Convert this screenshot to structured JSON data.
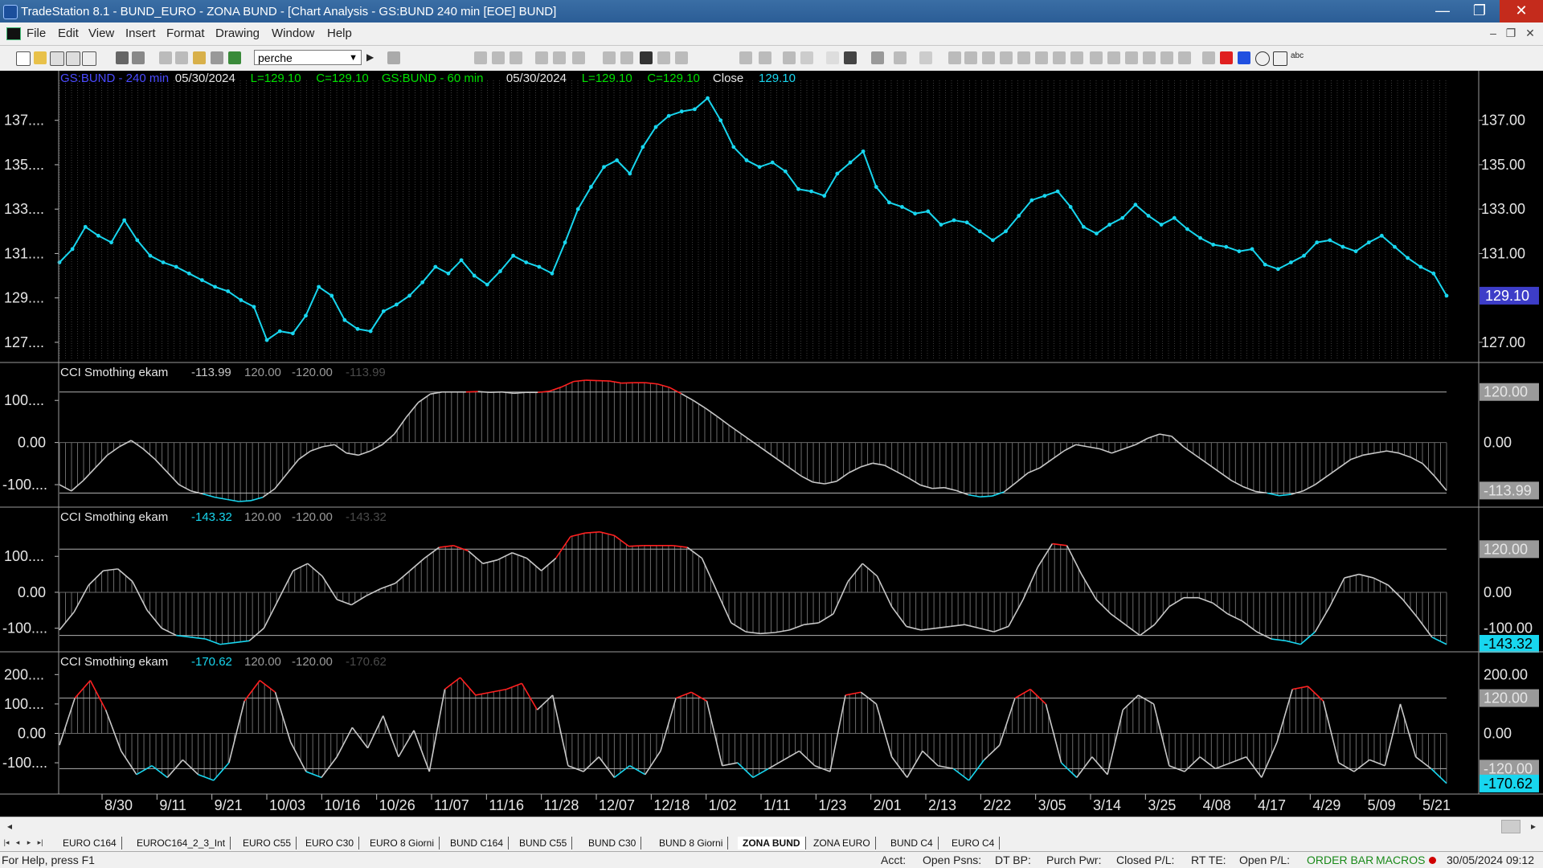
{
  "window": {
    "title": "TradeStation 8.1 - BUND_EURO - ZONA BUND - [Chart Analysis - GS:BUND  240 min  [EOE] BUND]",
    "controls": [
      "—",
      "❐",
      "✕"
    ]
  },
  "menu": [
    "File",
    "Edit",
    "View",
    "Insert",
    "Format",
    "Drawing",
    "Window",
    "Help"
  ],
  "mdi_controls": [
    "–",
    "❐",
    "✕"
  ],
  "toolbar": {
    "combo_value": "perche"
  },
  "price_pane": {
    "header": [
      {
        "text": "GS:BUND - 240 min",
        "color": "#4a4aff"
      },
      {
        "text": "05/30/2024",
        "color": "#e6e6e6"
      },
      {
        "text": "L=129.10",
        "color": "#00e000"
      },
      {
        "text": "C=129.10",
        "color": "#00e000"
      },
      {
        "text": "GS:BUND - 60 min",
        "color": "#00e000"
      },
      {
        "text": "05/30/2024",
        "color": "#e6e6e6"
      },
      {
        "text": "L=129.10",
        "color": "#00e000"
      },
      {
        "text": "C=129.10",
        "color": "#00e000"
      },
      {
        "text": "Close",
        "color": "#e6e6e6"
      },
      {
        "text": "129.10",
        "color": "#18d6ef"
      }
    ],
    "left_ticks": [
      "137....",
      "135....",
      "133....",
      "131....",
      "129....",
      "127...."
    ],
    "right_ticks": [
      "137.00",
      "135.00",
      "133.00",
      "131.00",
      "127.00"
    ],
    "last_value_label": "129.10"
  },
  "cci_panes": [
    {
      "name": "CCI Smothing ekam",
      "value": "-113.99",
      "upper": "120.00",
      "lower": "-120.00",
      "ghost": "-113.99",
      "left_ticks": [
        "100....",
        "0.00",
        "-100...."
      ],
      "right_ticks": [
        "120.00",
        "0.00",
        "-113.99"
      ]
    },
    {
      "name": "CCI Smothing ekam",
      "value": "-143.32",
      "upper": "120.00",
      "lower": "-120.00",
      "ghost": "-143.32",
      "left_ticks": [
        "100....",
        "0.00",
        "-100...."
      ],
      "right_ticks": [
        "120.00",
        "0.00",
        "-100.00",
        "-143.32"
      ]
    },
    {
      "name": "CCI Smothing ekam",
      "value": "-170.62",
      "upper": "120.00",
      "lower": "-120.00",
      "ghost": "-170.62",
      "left_ticks": [
        "200....",
        "100....",
        "0.00",
        "-100...."
      ],
      "right_ticks": [
        "200.00",
        "120.00",
        "0.00",
        "-120.00",
        "-170.62"
      ]
    }
  ],
  "x_axis_labels": [
    "8/30",
    "9/11",
    "9/21",
    "10/03",
    "10/16",
    "10/26",
    "11/07",
    "11/16",
    "11/28",
    "12/07",
    "12/18",
    "1/02",
    "1/11",
    "1/23",
    "2/01",
    "2/13",
    "2/22",
    "3/05",
    "3/14",
    "3/25",
    "4/08",
    "4/17",
    "4/29",
    "5/09",
    "5/21"
  ],
  "sheet_tabs": [
    {
      "label": "EURO C164",
      "active": false
    },
    {
      "label": "EUROC164_2_3_Int",
      "active": false
    },
    {
      "label": "EURO C55",
      "active": false
    },
    {
      "label": "EURO C30",
      "active": false
    },
    {
      "label": "EURO 8 Giorni",
      "active": false
    },
    {
      "label": "BUND C164",
      "active": false
    },
    {
      "label": "BUND C55",
      "active": false
    },
    {
      "label": "BUND  C30",
      "active": false
    },
    {
      "label": "BUND 8 Giorni",
      "active": false
    },
    {
      "label": "ZONA BUND",
      "active": true
    },
    {
      "label": "ZONA EURO",
      "active": false
    },
    {
      "label": "BUND C4",
      "active": false
    },
    {
      "label": "EURO C4",
      "active": false
    }
  ],
  "status": {
    "help": "For Help, press F1",
    "acct": "Acct:",
    "open_psns": "Open Psns:",
    "dt_bp": "DT BP:",
    "purch_pwr": "Purch Pwr:",
    "closed_pl": "Closed P/L:",
    "rt_te": "RT TE:",
    "open_pl": "Open P/L:",
    "order_bar": "ORDER BAR",
    "macros": "MACROS",
    "datetime": "30/05/2024 09:12"
  },
  "chart_data": [
    {
      "type": "line",
      "title": "GS:BUND - 240 min",
      "ylim": [
        126.2,
        138.8
      ],
      "x_axis": [
        "8/30",
        "9/11",
        "9/21",
        "10/03",
        "10/16",
        "10/26",
        "11/07",
        "11/16",
        "11/28",
        "12/07",
        "12/18",
        "1/02",
        "1/11",
        "1/23",
        "2/01",
        "2/13",
        "2/22",
        "3/05",
        "3/14",
        "3/25",
        "4/08",
        "4/17",
        "4/29",
        "5/09",
        "5/21"
      ],
      "series": [
        {
          "color": "#18d6ef",
          "values": [
            130.6,
            131.2,
            132.2,
            131.8,
            131.5,
            132.5,
            131.6,
            130.9,
            130.6,
            130.4,
            130.1,
            129.8,
            129.5,
            129.3,
            128.9,
            128.6,
            127.1,
            127.5,
            127.4,
            128.2,
            129.5,
            129.1,
            128.0,
            127.6,
            127.5,
            128.4,
            128.7,
            129.1,
            129.7,
            130.4,
            130.1,
            130.7,
            130.0,
            129.6,
            130.2,
            130.9,
            130.6,
            130.4,
            130.1,
            131.5,
            133.0,
            134.0,
            134.9,
            135.2,
            134.6,
            135.8,
            136.7,
            137.2,
            137.4,
            137.5,
            138.0,
            137.0,
            135.8,
            135.2,
            134.9,
            135.1,
            134.7,
            133.9,
            133.8,
            133.6,
            134.6,
            135.1,
            135.6,
            134.0,
            133.3,
            133.1,
            132.8,
            132.9,
            132.3,
            132.5,
            132.4,
            132.0,
            131.6,
            132.0,
            132.7,
            133.4,
            133.6,
            133.8,
            133.1,
            132.2,
            131.9,
            132.3,
            132.6,
            133.2,
            132.7,
            132.3,
            132.6,
            132.1,
            131.7,
            131.4,
            131.3,
            131.1,
            131.2,
            130.5,
            130.3,
            130.6,
            130.9,
            131.5,
            131.6,
            131.3,
            131.1,
            131.5,
            131.8,
            131.3,
            130.8,
            130.4,
            130.1,
            129.1
          ]
        }
      ]
    },
    {
      "type": "area",
      "title": "CCI Smothing ekam",
      "ylim": [
        -140,
        150
      ],
      "reference_lines": [
        120,
        -120,
        0
      ],
      "colors": {
        "above": "#ff2020",
        "below": "#18d6ef",
        "normal": "#c8c8c8"
      },
      "series": [
        {
          "name": "CCI Smothing ekam",
          "values": [
            -100,
            -115,
            -90,
            -60,
            -30,
            -10,
            5,
            -15,
            -40,
            -70,
            -100,
            -115,
            -122,
            -130,
            -135,
            -140,
            -138,
            -130,
            -110,
            -75,
            -40,
            -20,
            -10,
            -5,
            -25,
            -30,
            -20,
            -5,
            20,
            60,
            95,
            115,
            120,
            120,
            120,
            121,
            119,
            120,
            117,
            119,
            119,
            122,
            132,
            145,
            148,
            147,
            146,
            141,
            142,
            142,
            139,
            131,
            116,
            100,
            82,
            62,
            41,
            21,
            1,
            -19,
            -39,
            -59,
            -79,
            -94,
            -98,
            -92,
            -72,
            -58,
            -49,
            -54,
            -69,
            -84,
            -101,
            -109,
            -107,
            -114,
            -124,
            -129,
            -127,
            -117,
            -95,
            -72,
            -60,
            -40,
            -20,
            -5,
            -10,
            -15,
            -25,
            -15,
            -5,
            10,
            20,
            15,
            -10,
            -30,
            -50,
            -70,
            -90,
            -105,
            -116,
            -120,
            -126,
            -123,
            -115,
            -100,
            -80,
            -60,
            -40,
            -30,
            -25,
            -20,
            -25,
            -35,
            -50,
            -80,
            -114
          ]
        }
      ]
    },
    {
      "type": "area",
      "title": "CCI Smothing ekam",
      "ylim": [
        -150,
        190
      ],
      "reference_lines": [
        120,
        -120,
        0
      ],
      "colors": {
        "above": "#ff2020",
        "below": "#18d6ef",
        "normal": "#c8c8c8"
      },
      "series": [
        {
          "name": "CCI Smothing ekam",
          "values": [
            -105,
            -55,
            20,
            60,
            65,
            30,
            -50,
            -100,
            -120,
            -125,
            -130,
            -145,
            -140,
            -135,
            -100,
            -20,
            60,
            80,
            45,
            -20,
            -35,
            -10,
            10,
            25,
            60,
            95,
            125,
            130,
            115,
            80,
            90,
            110,
            95,
            60,
            95,
            155,
            165,
            168,
            158,
            128,
            130,
            130,
            130,
            125,
            95,
            5,
            -85,
            -110,
            -115,
            -112,
            -105,
            -90,
            -85,
            -60,
            30,
            80,
            45,
            -40,
            -95,
            -105,
            -100,
            -95,
            -90,
            -100,
            -110,
            -95,
            -20,
            70,
            135,
            130,
            50,
            -20,
            -60,
            -90,
            -120,
            -90,
            -40,
            -15,
            -15,
            -30,
            -60,
            -80,
            -110,
            -130,
            -135,
            -145,
            -110,
            -40,
            40,
            50,
            40,
            20,
            -20,
            -70,
            -125,
            -145
          ]
        }
      ]
    },
    {
      "type": "area",
      "title": "CCI Smothing ekam",
      "ylim": [
        -190,
        220
      ],
      "reference_lines": [
        120,
        -120,
        0
      ],
      "colors": {
        "above": "#ff2020",
        "below": "#18d6ef",
        "normal": "#c8c8c8"
      },
      "series": [
        {
          "name": "CCI Smothing ekam",
          "values": [
            -40,
            120,
            180,
            80,
            -60,
            -140,
            -110,
            -150,
            -90,
            -140,
            -160,
            -100,
            110,
            180,
            140,
            -30,
            -130,
            -150,
            -80,
            20,
            -50,
            60,
            -80,
            10,
            -130,
            150,
            190,
            130,
            140,
            150,
            170,
            80,
            130,
            -110,
            -130,
            -80,
            -150,
            -110,
            -140,
            -60,
            120,
            140,
            110,
            -110,
            -100,
            -150,
            -120,
            -90,
            -60,
            -110,
            -130,
            130,
            140,
            100,
            -80,
            -150,
            -60,
            -110,
            -120,
            -160,
            -90,
            -40,
            120,
            150,
            100,
            -100,
            -150,
            -80,
            -140,
            80,
            130,
            100,
            -110,
            -130,
            -80,
            -120,
            -100,
            -80,
            -150,
            -30,
            150,
            160,
            110,
            -100,
            -130,
            -90,
            -110,
            100,
            -80,
            -120,
            -170
          ]
        }
      ]
    }
  ]
}
